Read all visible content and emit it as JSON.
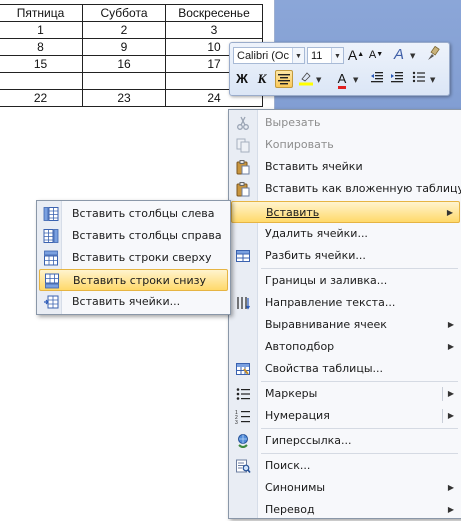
{
  "table": {
    "headers": [
      "Пятница",
      "Суббота",
      "Воскресенье"
    ],
    "rows": [
      [
        "1",
        "2",
        "3"
      ],
      [
        "8",
        "9",
        "10"
      ],
      [
        "15",
        "16",
        "17"
      ],
      [
        "",
        "",
        ""
      ],
      [
        "22",
        "23",
        "24"
      ]
    ]
  },
  "mini_toolbar": {
    "font_name": "Calibri (Ос",
    "font_size": "11",
    "bold_label": "Ж",
    "italic_label": "К",
    "grow_font_label": "A",
    "shrink_font_label": "A",
    "font_color_label": "A",
    "styles_label": "A",
    "highlight_color": "#ffff00",
    "font_color": "#e02020"
  },
  "context_menu": {
    "items": [
      {
        "label": "Вырезать",
        "disabled": true,
        "icon": "scissors-icon"
      },
      {
        "label": "Копировать",
        "disabled": true,
        "icon": "copy-icon"
      },
      {
        "label": "Вставить ячейки",
        "icon": "paste-icon"
      },
      {
        "label": "Вставить как вложенную таблицу",
        "icon": "paste-icon"
      },
      {
        "label": "Вставить",
        "submenu": true,
        "highlighted": true
      },
      {
        "label": "Удалить ячейки..."
      },
      {
        "label": "Разбить ячейки...",
        "icon": "split-cells-icon"
      },
      {
        "label": "Границы и заливка..."
      },
      {
        "label": "Направление текста...",
        "icon": "text-direction-icon"
      },
      {
        "label": "Выравнивание ячеек",
        "submenu": true
      },
      {
        "label": "Автоподбор",
        "submenu": true
      },
      {
        "label": "Свойства таблицы...",
        "icon": "table-properties-icon"
      },
      {
        "label": "Маркеры",
        "submenu": true,
        "icon": "bullets-icon"
      },
      {
        "label": "Нумерация",
        "submenu": true,
        "icon": "numbering-icon"
      },
      {
        "label": "Гиперссылка...",
        "icon": "hyperlink-icon"
      },
      {
        "label": "Поиск...",
        "icon": "research-icon"
      },
      {
        "label": "Синонимы",
        "submenu": true
      },
      {
        "label": "Перевод",
        "submenu": true
      }
    ]
  },
  "insert_submenu": {
    "items": [
      {
        "label": "Вставить столбцы слева",
        "icon": "insert-columns-left-icon"
      },
      {
        "label": "Вставить столбцы справа",
        "icon": "insert-columns-right-icon"
      },
      {
        "label": "Вставить строки сверху",
        "icon": "insert-rows-above-icon"
      },
      {
        "label": "Вставить строки снизу",
        "icon": "insert-rows-below-icon",
        "highlighted": true
      },
      {
        "label": "Вставить ячейки...",
        "icon": "insert-cells-icon"
      }
    ]
  }
}
